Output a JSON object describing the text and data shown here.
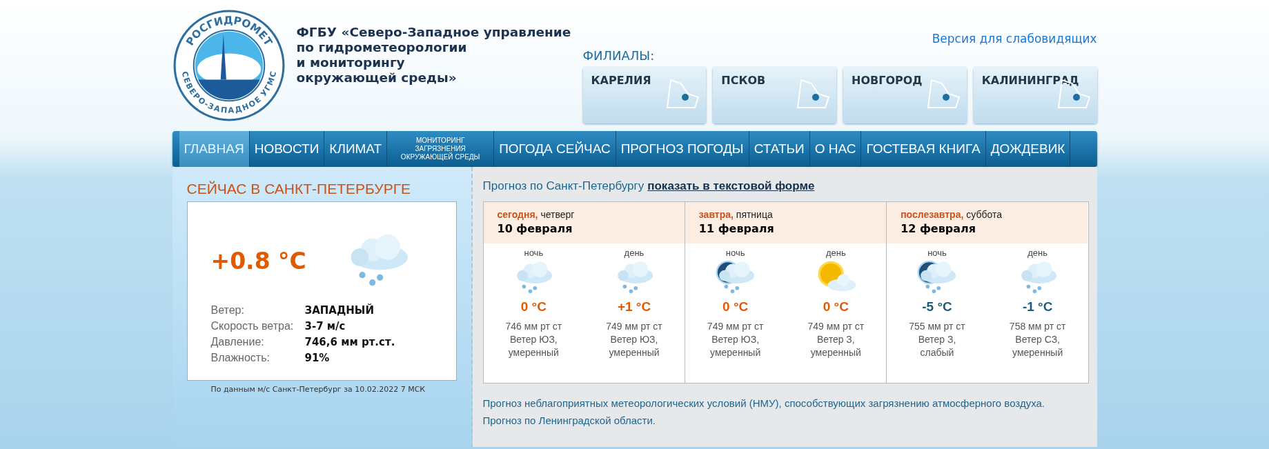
{
  "logo": {
    "top_text": "РОСГИДРОМЕТ",
    "bottom_text": "СЕВЕРО-ЗАПАДНОЕ УГМС"
  },
  "org_title_lines": [
    "ФГБУ «Северо-Западное управление",
    "по гидрометеорологии",
    "и мониторингу",
    "окружающей среды»"
  ],
  "accessibility_link": "Версия для слабовидящих",
  "branches_label": "ФИЛИАЛЫ:",
  "branches": [
    "КАРЕЛИЯ",
    "ПСКОВ",
    "НОВГОРОД",
    "КАЛИНИНГРАД"
  ],
  "nav": [
    {
      "label": "ГЛАВНАЯ",
      "selected": true,
      "kind": "normal"
    },
    {
      "label": "НОВОСТИ",
      "selected": false,
      "kind": "normal"
    },
    {
      "label": "КЛИМАТ",
      "selected": false,
      "kind": "normal"
    },
    {
      "label": "МОНИТОРИНГ ЗАГРЯЗНЕНИЯ ОКРУЖАЮЩЕЙ СРЕДЫ",
      "selected": false,
      "kind": "small"
    },
    {
      "label": "ПОГОДА СЕЙЧАС",
      "selected": false,
      "kind": "normal"
    },
    {
      "label": "ПРОГНОЗ ПОГОДЫ",
      "selected": false,
      "kind": "normal"
    },
    {
      "label": "СТАТЬИ",
      "selected": false,
      "kind": "normal"
    },
    {
      "label": "О НАС",
      "selected": false,
      "kind": "normal"
    },
    {
      "label": "ГОСТЕВАЯ КНИГА",
      "selected": false,
      "kind": "normal"
    },
    {
      "label": "ДОЖДЕВИК",
      "selected": false,
      "kind": "normal"
    }
  ],
  "current": {
    "title": "СЕЙЧАС В САНКТ-ПЕТЕРБУРГЕ",
    "temperature": "+0.8 °C",
    "kind": "snow",
    "rows": [
      {
        "label": "Ветер:",
        "value": "ЗАПАДНЫЙ"
      },
      {
        "label": "Скорость ветра:",
        "value": "3-7 м/с"
      },
      {
        "label": "Давление:",
        "value": "746,6 мм рт.ст."
      },
      {
        "label": "Влажность:",
        "value": "91%"
      }
    ],
    "source": "По данным м/с Санкт-Петербург за 10.02.2022 7 МСК"
  },
  "forecast": {
    "title": "Прогноз по Санкт-Петербургу",
    "text_link": "показать в текстовой форме",
    "days": [
      {
        "relative": "сегодня,",
        "weekday": "четверг",
        "date": "10 февраля",
        "periods": [
          {
            "name": "ночь",
            "kind": "snow",
            "temp": "0 °C",
            "color": "#e05a00",
            "pressure": "746 мм рт ст",
            "wind": "Ветер ЮЗ,",
            "strength": "умеренный"
          },
          {
            "name": "день",
            "kind": "snow",
            "temp": "+1 °C",
            "color": "#e05a00",
            "pressure": "749 мм рт ст",
            "wind": "Ветер ЮЗ,",
            "strength": "умеренный"
          }
        ]
      },
      {
        "relative": "завтра,",
        "weekday": "пятница",
        "date": "11 февраля",
        "periods": [
          {
            "name": "ночь",
            "kind": "moon-snow",
            "temp": "0 °C",
            "color": "#e05a00",
            "pressure": "749 мм рт ст",
            "wind": "Ветер ЮЗ,",
            "strength": "умеренный"
          },
          {
            "name": "день",
            "kind": "sun-cloud",
            "temp": "0 °C",
            "color": "#e05a00",
            "pressure": "749 мм рт ст",
            "wind": "Ветер З,",
            "strength": "умеренный"
          }
        ]
      },
      {
        "relative": "послезавтра,",
        "weekday": "суббота",
        "date": "12 февраля",
        "periods": [
          {
            "name": "ночь",
            "kind": "moon-snow",
            "temp": "-5 °C",
            "color": "#1d5b78",
            "pressure": "755 мм рт ст",
            "wind": "Ветер З,",
            "strength": "слабый"
          },
          {
            "name": "день",
            "kind": "snow",
            "temp": "-1 °C",
            "color": "#1d5b78",
            "pressure": "758 мм рт ст",
            "wind": "Ветер СЗ,",
            "strength": "умеренный"
          }
        ]
      }
    ]
  },
  "links": [
    "Прогноз неблагоприятных метеорологических условий (НМУ), способствующих загрязнению атмосферного воздуха.",
    "Прогноз по Ленинградской области."
  ]
}
